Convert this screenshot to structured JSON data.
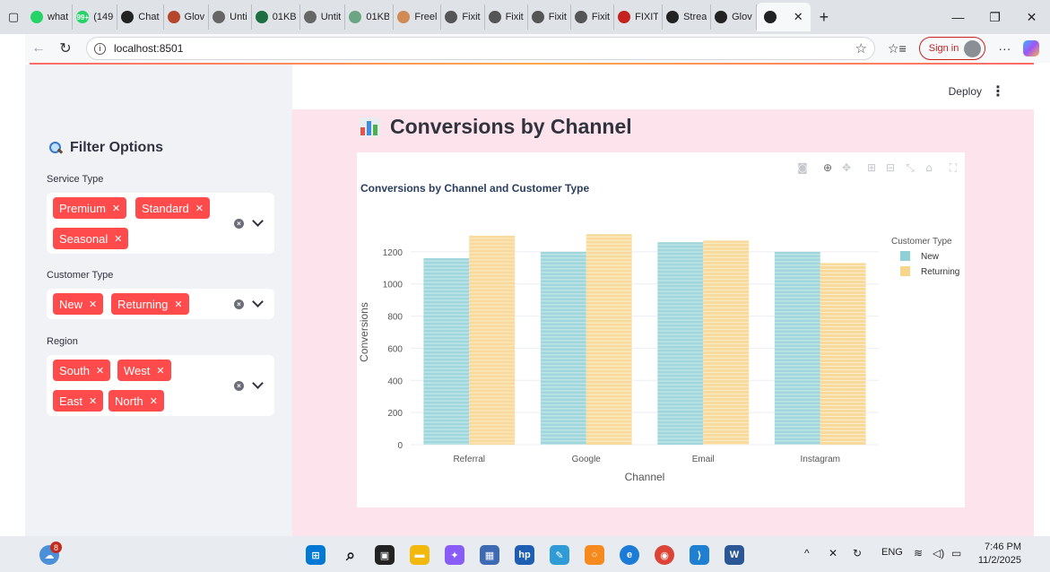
{
  "browser": {
    "tabs": [
      {
        "label": "what",
        "icon": "whatsapp-icon",
        "color": "#25d366",
        "badge": ""
      },
      {
        "label": "(149",
        "icon": "whatsapp-icon",
        "color": "#25d366",
        "badge": "99+"
      },
      {
        "label": "Chat",
        "icon": "chatgpt-icon",
        "color": "#222222",
        "badge": ""
      },
      {
        "label": "Glov",
        "icon": "glove-icon",
        "color": "#b5452b",
        "badge": ""
      },
      {
        "label": "Unti",
        "icon": "document-icon",
        "color": "#666666",
        "badge": ""
      },
      {
        "label": "01KB",
        "icon": "excel-icon",
        "color": "#1d6f42",
        "badge": ""
      },
      {
        "label": "Untit",
        "icon": "document-icon",
        "color": "#666666",
        "badge": ""
      },
      {
        "label": "01KB",
        "icon": "sheet-icon",
        "color": "#6aa584",
        "badge": ""
      },
      {
        "label": "Freel",
        "icon": "freelancer-icon",
        "color": "#d08a55",
        "badge": ""
      },
      {
        "label": "Fixit",
        "icon": "fixit-icon",
        "color": "#555555",
        "badge": ""
      },
      {
        "label": "Fixit",
        "icon": "fixit-icon",
        "color": "#555555",
        "badge": ""
      },
      {
        "label": "Fixit",
        "icon": "fixit-icon",
        "color": "#555555",
        "badge": ""
      },
      {
        "label": "Fixit",
        "icon": "fixit-icon",
        "color": "#555555",
        "badge": ""
      },
      {
        "label": "FIXIT",
        "icon": "pdf-icon",
        "color": "#c5221f",
        "badge": ""
      },
      {
        "label": "Strea",
        "icon": "streamlit-icon",
        "color": "#222222",
        "badge": ""
      },
      {
        "label": "Glov",
        "icon": "streamlit-icon",
        "color": "#222222",
        "badge": ""
      }
    ],
    "url": "localhost:8501",
    "signin_label": "Sign in"
  },
  "app": {
    "deploy_label": "Deploy",
    "sidebar": {
      "title": "Filter Options",
      "filters": [
        {
          "label": "Service Type",
          "chips": [
            "Premium",
            "Standard",
            "Seasonal"
          ]
        },
        {
          "label": "Customer Type",
          "chips": [
            "New",
            "Returning"
          ]
        },
        {
          "label": "Region",
          "chips": [
            "South",
            "West",
            "East",
            "North"
          ]
        }
      ]
    },
    "heading": "Conversions by Channel"
  },
  "chart_data": {
    "type": "bar",
    "title": "Conversions by Channel and Customer Type",
    "xlabel": "Channel",
    "ylabel": "Conversions",
    "categories": [
      "Referral",
      "Google",
      "Email",
      "Instagram"
    ],
    "series": [
      {
        "name": "New",
        "color": "#8fd0d6",
        "values": [
          1160,
          1200,
          1260,
          1200
        ]
      },
      {
        "name": "Returning",
        "color": "#f7d58b",
        "values": [
          1300,
          1310,
          1270,
          1130
        ]
      }
    ],
    "ylim": [
      0,
      1400
    ],
    "yticks": [
      0,
      200,
      400,
      600,
      800,
      1000,
      1200
    ],
    "legend_title": "Customer Type",
    "legend_position": "top-right",
    "grid": true,
    "modebar_icons": [
      "camera-icon",
      "zoom-icon",
      "pan-icon",
      "zoom-in-icon",
      "zoom-out-icon",
      "autoscale-icon",
      "home-icon",
      "fullscreen-icon"
    ]
  },
  "taskbar": {
    "notification_count": "8",
    "language": "ENG",
    "time": "7:46 PM",
    "date": "11/2/2025"
  }
}
